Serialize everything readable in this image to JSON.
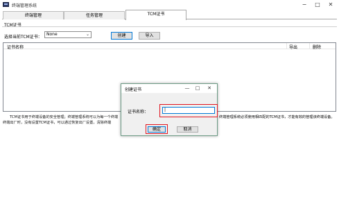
{
  "window": {
    "title": "终端管理系统",
    "controls": [
      "−",
      "□",
      "✕"
    ]
  },
  "tabs": [
    {
      "label": "终端管理",
      "active": false
    },
    {
      "label": "任务管理",
      "active": false
    },
    {
      "label": "TCM证书",
      "active": true
    }
  ],
  "tcm": {
    "group_label": "TCM证书",
    "select_label": "选择当前TCM证书：",
    "select_value": "None",
    "create_button": "创建",
    "import_button": "导入",
    "columns": [
      "证书名称",
      "导出",
      "删除"
    ],
    "description": [
      "TCM证书用于终端设备的安全管理；终端管理系统可以为每一个终端",
      "终端出厂时，没有设置TCM证书，可以通过恢复出厂设置，清除终端",
      "终端管理系统必须使用相匹配的TCM证书，才能有效的管理该终端设备。"
    ]
  },
  "dialog": {
    "title": "创建证书",
    "controls": [
      "—",
      "□",
      "✕"
    ],
    "name_label": "证书名称：",
    "name_value": "|",
    "ok_button": "确定",
    "cancel_button": "取消"
  },
  "colors": {
    "highlight": "#e0141e",
    "focus": "#0078d7",
    "dialog_border": "#6b9a84"
  }
}
